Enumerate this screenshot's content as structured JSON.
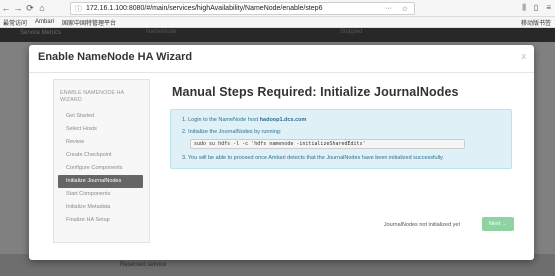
{
  "browser": {
    "url": "172.16.1.100:8080/#/main/services/highAvailability/NameNode/enable/step6",
    "menu_dots": "···",
    "bookmarks": [
      "最常访问",
      "Ambari",
      "国家中国特管理平台"
    ],
    "mobile_bookmarks": "移动版书签"
  },
  "page_behind": {
    "service_label": "Service Metrics",
    "namenode_label": "NameNode",
    "stopped_badge": "Stopped",
    "footer_label": "Reserved service"
  },
  "modal": {
    "title": "Enable NameNode HA Wizard",
    "close": "x",
    "sidebar_header": "ENABLE NAMENODE HA WIZARD",
    "steps": [
      "Get Started",
      "Select Hosts",
      "Review",
      "Create Checkpoint",
      "Configure Components",
      "Initialize JournalNodes",
      "Start Components",
      "Initialize Metadata",
      "Finalize HA Setup"
    ],
    "active_step": 5,
    "content_title": "Manual Steps Required: Initialize JournalNodes",
    "instructions": {
      "step1_prefix": "1. Login to the NameNode host ",
      "step1_host": "hadoop1.dcs.com",
      "step2": "2. Initialize the JournalNodes by running:",
      "command": "sudo su hdfs -l -c 'hdfs namenode -initializeSharedEdits'",
      "step3": "3. You will be able to proceed once Ambari detects that the JournalNodes have been initialized successfully."
    },
    "status_text": "JournalNodes not initialized yet",
    "next_label": "Next →"
  },
  "colors": {
    "active_step_bg": "#666666",
    "info_bg": "#dff0f7",
    "next_button": "#8fd3a3"
  }
}
